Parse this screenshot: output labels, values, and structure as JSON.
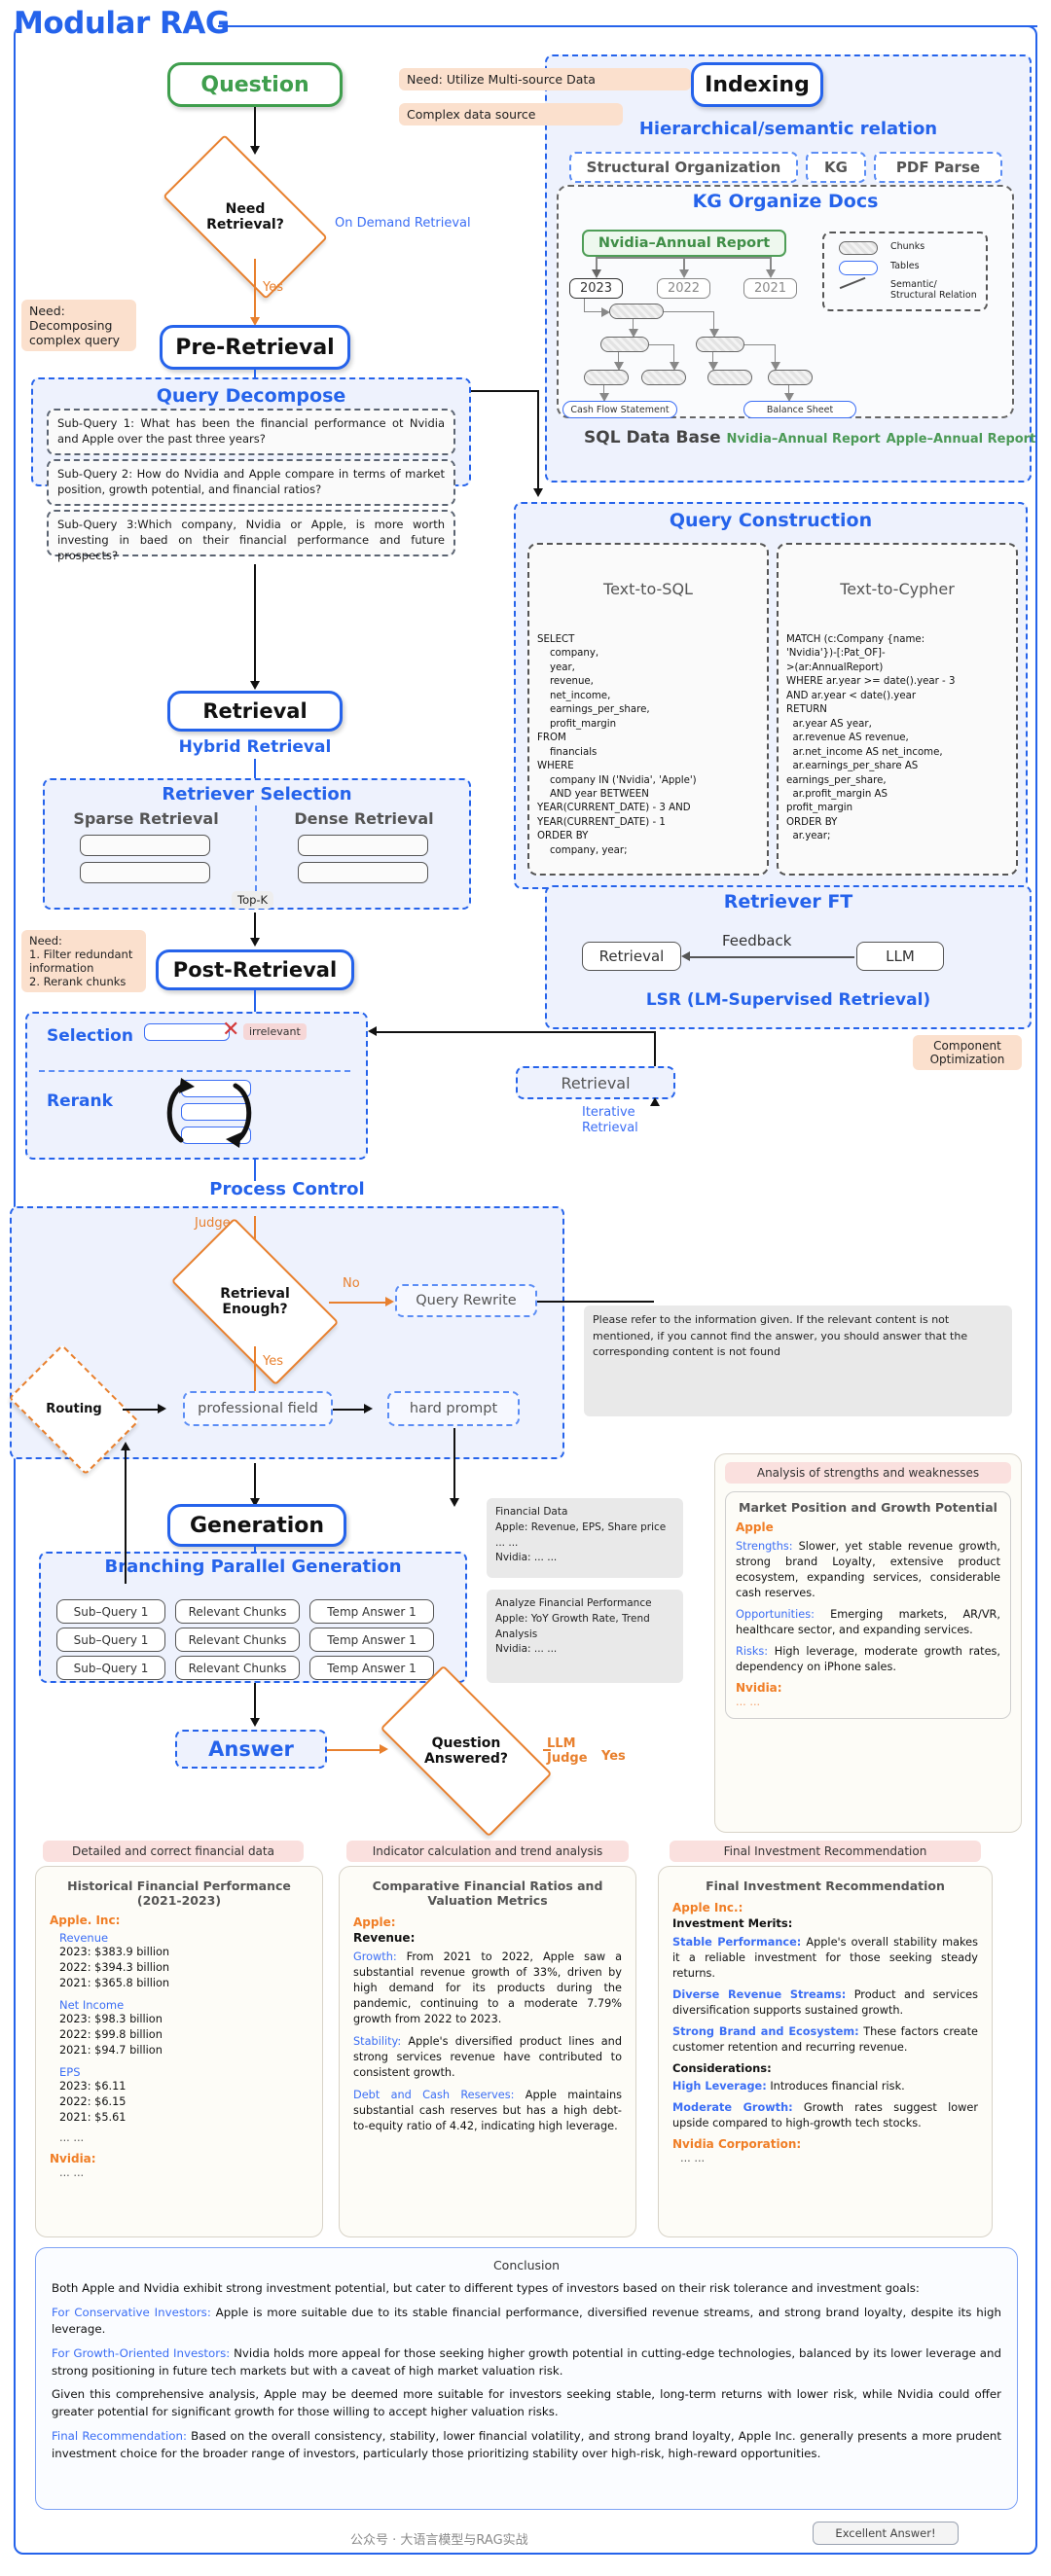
{
  "title": "Modular RAG",
  "nodes": {
    "question": "Question",
    "need_retrieval": "Need\nRetrieval?",
    "on_demand": "On Demand Retrieval",
    "yes1": "Yes",
    "pre_retrieval": "Pre-Retrieval",
    "retrieval": "Retrieval",
    "post_retrieval": "Post-Retrieval",
    "generation": "Generation",
    "answer": "Answer",
    "question_answered": "Question\nAnswered?",
    "llm_judge": "LLM\nJudge",
    "yes_final": "Yes",
    "indexing": "Indexing"
  },
  "needs": {
    "multi_source": "Need: Utilize Multi-source Data",
    "complex_source": "Complex data source",
    "decompose": "Need:\nDecomposing\ncomplex query",
    "postretrieval": "Need:\n1. Filter redundant\ninformation\n2. Rerank chunks",
    "component_opt": "Component\nOptimization"
  },
  "indexing": {
    "hierarchical": "Hierarchical/semantic relation",
    "tags": [
      "Structural Organization",
      "KG",
      "PDF Parse"
    ],
    "kg_title": "KG Organize Docs",
    "root": "Nvidia–Annual Report",
    "years": [
      "2023",
      "2022",
      "2021"
    ],
    "tables": [
      "Cash Flow Statement",
      "Balance Sheet"
    ],
    "legend": [
      "Chunks",
      "Tables",
      "Semantic/\nStructural Relation"
    ],
    "sqldb": "SQL Data Base",
    "sqldb_items": [
      "Nvidia–Annual Report",
      "Apple–Annual Report"
    ]
  },
  "query_decompose": {
    "title": "Query Decompose",
    "subqueries": [
      "Sub-Query 1: What has been the financial performance ot Nvidia and Apple over the past three years?",
      "Sub-Query 2: How do Nvidia and Apple compare in terms of market position, growth potential, and financial ratios?",
      "Sub-Query 3:Which company, Nvidia or Apple, is more worth investing in baed on their financial performance and future prospects?"
    ]
  },
  "query_construction": {
    "title": "Query Construction",
    "sql_head": "Text-to-SQL",
    "cypher_head": "Text-to-Cypher",
    "sql": "SELECT\n    company,\n    year,\n    revenue,\n    net_income,\n    earnings_per_share,\n    profit_margin\nFROM\n    financials\nWHERE\n    company IN ('Nvidia', 'Apple')\n    AND year BETWEEN\nYEAR(CURRENT_DATE) - 3 AND\nYEAR(CURRENT_DATE) - 1\nORDER BY\n    company, year;",
    "cypher": "MATCH (c:Company {name:\n'Nvidia'})-[:Pat_OF]-\n>(ar:AnnualReport)\nWHERE ar.year >= date().year - 3\nAND ar.year < date().year\nRETURN\n  ar.year AS year,\n  ar.revenue AS revenue,\n  ar.net_income AS net_income,\n  ar.earnings_per_share AS\nearnings_per_share,\n  ar.profit_margin AS\nprofit_margin\nORDER BY\n  ar.year;"
  },
  "retrieval": {
    "hybrid": "Hybrid Retrieval",
    "selection_title": "Retriever Selection",
    "sparse": "Sparse Retrieval",
    "dense": "Dense Retrieval",
    "topk": "Top-K"
  },
  "retriever_ft": {
    "title": "Retriever FT",
    "retrieval": "Retrieval",
    "feedback": "Feedback",
    "llm": "LLM",
    "lsr": "LSR (LM-Supervised Retrieval)"
  },
  "post": {
    "selection": "Selection",
    "rerank": "Rerank",
    "irrelevant": "irrelevant",
    "retrieval_box": "Retrieval",
    "iterative": "Iterative\nRetrieval"
  },
  "process_control": {
    "title": "Process Control",
    "judge": "Judge",
    "retrieval_enough": "Retrieval\nEnough?",
    "no": "No",
    "yes": "Yes",
    "query_rewrite": "Query Rewrite",
    "routing": "Routing",
    "professional_field": "professional field",
    "hard_prompt": "hard prompt",
    "prompt_text": "Please refer to the information given. If the relevant content is not mentioned, if you cannot find the answer, you should answer that the corresponding content is not found"
  },
  "generation": {
    "title": "Branching Parallel Generation",
    "rows": [
      [
        "Sub–Query 1",
        "Relevant Chunks",
        "Temp Answer 1"
      ],
      [
        "Sub–Query 1",
        "Relevant Chunks",
        "Temp Answer 1"
      ],
      [
        "Sub–Query 1",
        "Relevant Chunks",
        "Temp Answer 1"
      ]
    ],
    "financial_data": "Financial Data\nApple: Revenue, EPS, Share price ... ...\nNvidia: ... ...",
    "analyze": "Analyze Financial Performance\nApple: YoY Growth Rate, Trend Analysis\nNvidia: ... ..."
  },
  "analysis": {
    "header": "Analysis of strengths and weaknesses",
    "inner_title": "Market Position and Growth Potential",
    "company": "Apple",
    "strengths_label": "Strengths:",
    "strengths": " Slower, yet stable revenue growth, strong brand Loyalty, extensive product ecosystem, expanding services, considerable cash reserves.",
    "opportunities_label": "Opportunities:",
    "opportunities": " Emerging markets, AR/VR, healthcare sector, and expanding services.",
    "risks_label": "Risks:",
    "risks": " High leverage, moderate growth rates, dependency on iPhone sales.",
    "nvidia_label": "Nvidia:",
    "nvidia_body": "... ..."
  },
  "columns": [
    {
      "header": "Detailed and correct financial data",
      "title": "Historical Financial Performance\n(2021-2023)",
      "company": "Apple. Inc:",
      "groups": [
        {
          "label": "Revenue",
          "lines": [
            "2023: $383.9 billion",
            "2022: $394.3 billion",
            "2021: $365.8 billion"
          ]
        },
        {
          "label": "Net Income",
          "lines": [
            "2023: $98.3 billion",
            "2022: $99.8 billion",
            "2021: $94.7 billion"
          ]
        },
        {
          "label": "EPS",
          "lines": [
            "2023: $6.11",
            "2022: $6.15",
            "2021: $5.61"
          ]
        }
      ],
      "ellipsis": "... ...",
      "second_company": "Nvidia:",
      "second_body": "... ..."
    },
    {
      "header": "Indicator calculation and trend analysis",
      "title": "Comparative Financial Ratios and\nValuation Metrics",
      "company": "Apple:",
      "subhead": "Revenue:",
      "items": [
        {
          "label": "Growth:",
          "body": " From 2021 to 2022, Apple saw a substantial revenue growth of 33%, driven by high demand for its products during the pandemic, continuing to a moderate 7.79% growth from 2022 to 2023."
        },
        {
          "label": "Stability:",
          "body": " Apple's diversified product lines and strong services revenue have contributed to consistent growth."
        },
        {
          "label": "Debt and Cash Reserves:",
          "body": " Apple maintains substantial cash reserves but has a high debt-to-equity ratio of 4.42, indicating high leverage."
        }
      ]
    },
    {
      "header": "Final Investment Recommendation",
      "title": "Final Investment Recommendation",
      "company": "Apple Inc.:",
      "subhead": "Investment Merits:",
      "items": [
        {
          "label": "Stable Performance:",
          "body": " Apple's overall stability makes it a reliable investment for those seeking steady returns."
        },
        {
          "label": "Diverse Revenue Streams:",
          "body": " Product and services diversification supports sustained growth."
        },
        {
          "label": "Strong Brand and Ecosystem:",
          "body": " These factors create customer retention and recurring revenue."
        }
      ],
      "considerations": "Considerations:",
      "consideration_items": [
        {
          "label": "High Leverage:",
          "body": " Introduces financial risk."
        },
        {
          "label": "Moderate Growth:",
          "body": " Growth rates suggest lower upside compared to high-growth tech stocks."
        }
      ],
      "second_company": "Nvidia Corporation:",
      "second_body": "... ..."
    }
  ],
  "conclusion": {
    "title": "Conclusion",
    "intro": "Both Apple and Nvidia exhibit strong investment potential, but cater to different types of investors based on their risk tolerance and investment goals:",
    "items": [
      {
        "label": "For Conservative Investors:",
        "body": " Apple is more suitable due to its stable financial performance, diversified revenue streams, and strong brand loyalty, despite its high leverage."
      },
      {
        "label": "For Growth-Oriented Investors:",
        "body": " Nvidia holds more appeal for those seeking higher growth potential in cutting-edge technologies, balanced by its lower leverage and strong positioning in future tech markets but with a caveat of high market valuation risk."
      }
    ],
    "given": "Given this comprehensive analysis, Apple may be deemed more suitable for investors seeking stable, long-term returns with lower risk, while Nvidia could offer greater potential for significant growth for those willing to accept higher valuation risks.",
    "final_label": "Final Recommendation:",
    "final_body": " Based on the overall consistency, stability, lower financial volatility, and strong brand loyalty, Apple Inc. generally presents a more prudent investment choice for the broader range of investors, particularly those prioritizing stability over high-risk, high-reward opportunities."
  },
  "watermark": "公众号 · 大语言模型与RAG实战",
  "excellent": "Excellent Answer!"
}
